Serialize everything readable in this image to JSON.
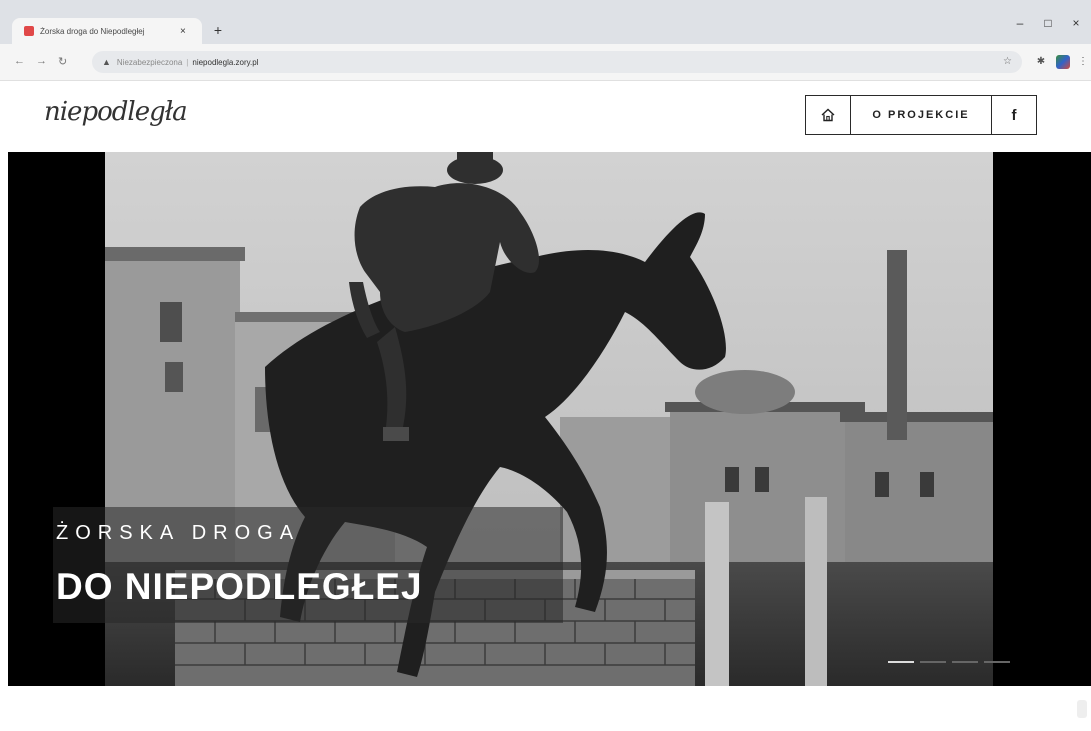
{
  "browser": {
    "tab_title": "Żorska droga do Niepodległej",
    "tab_close": "×",
    "new_tab": "+",
    "security_label": "Niezabezpieczona",
    "separator": "|",
    "url": "niepodlegla.zory.pl",
    "window_controls": {
      "minimize": "–",
      "maximize": "□",
      "close": "×"
    }
  },
  "header": {
    "logo_text": "niepodległa",
    "nav": {
      "about_label": "O PROJEKCIE",
      "facebook_label": "f"
    }
  },
  "hero": {
    "caption_line1": "ŻORSKA DROGA",
    "caption_line2": "DO NIEPODLEGŁEJ",
    "slide_count": 4,
    "active_slide": 1
  },
  "colors": {
    "accent_red": "#e04848",
    "nav_border": "#2a2a2a",
    "caption_overlay": "rgba(40,40,40,0.55)"
  }
}
